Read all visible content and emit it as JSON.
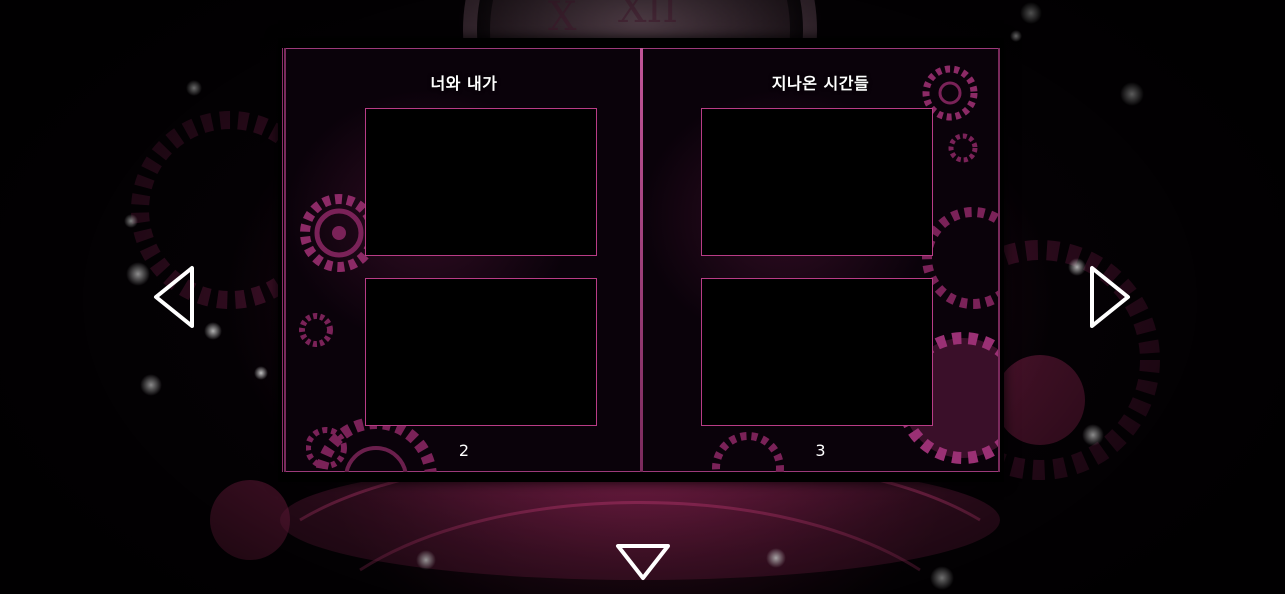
{
  "album": {
    "left_page": {
      "title": "너와 내가",
      "page_number": "2",
      "slots": [
        "empty",
        "empty"
      ]
    },
    "right_page": {
      "title": "지나온 시간들",
      "page_number": "3",
      "slots": [
        "empty",
        "empty"
      ]
    }
  },
  "navigation": {
    "prev_icon": "triangle-left-outline-icon",
    "next_icon": "triangle-right-outline-icon",
    "close_icon": "triangle-down-outline-icon"
  },
  "colors": {
    "accent": "#b83c86",
    "frame": "#7a2a5c",
    "text": "#ffffff",
    "background": "#050105"
  }
}
